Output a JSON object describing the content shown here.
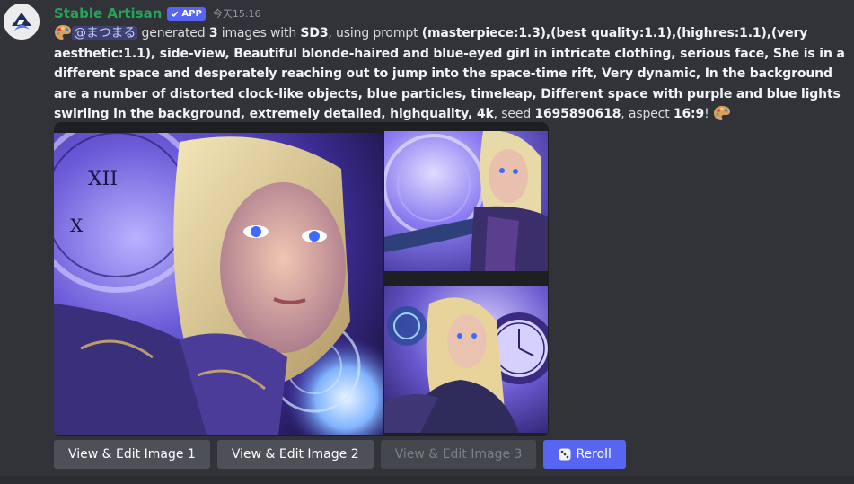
{
  "message": {
    "author": "Stable Artisan",
    "badge": "APP",
    "timestamp": "今天15:16",
    "mention": "@まつまる",
    "text_generated": " generated ",
    "image_count": "3",
    "text_images_with": " images with ",
    "model": "SD3",
    "text_using_prompt": ", using prompt ",
    "prompt": "(masterpiece:1.3),(best quality:1.1),(highres:1.1),(very aesthetic:1.1), side-view, Beautiful blonde-haired and blue-eyed girl in intricate clothing, serious face, She is in a different space and desperately reaching out to jump into the space-time rift, Very dynamic, In the background are a number of distorted clock-like objects, blue particles, timeleap, Different space with purple and blue lights swirling in the background, extremely detailed, highquality, 4k",
    "text_seed": ", seed ",
    "seed": "1695890618",
    "text_aspect": ", aspect ",
    "aspect": "16:9",
    "text_end": "!"
  },
  "buttons": {
    "edit1": "View & Edit Image 1",
    "edit2": "View & Edit Image 2",
    "edit3": "View & Edit Image 3",
    "reroll": "Reroll"
  },
  "colors": {
    "background": "#313338",
    "author": "#23a559",
    "brand": "#5865f2",
    "button_grey": "#4e5058"
  },
  "icons": [
    "avatar-logo",
    "palette-icon",
    "check-icon",
    "dice-icon"
  ]
}
